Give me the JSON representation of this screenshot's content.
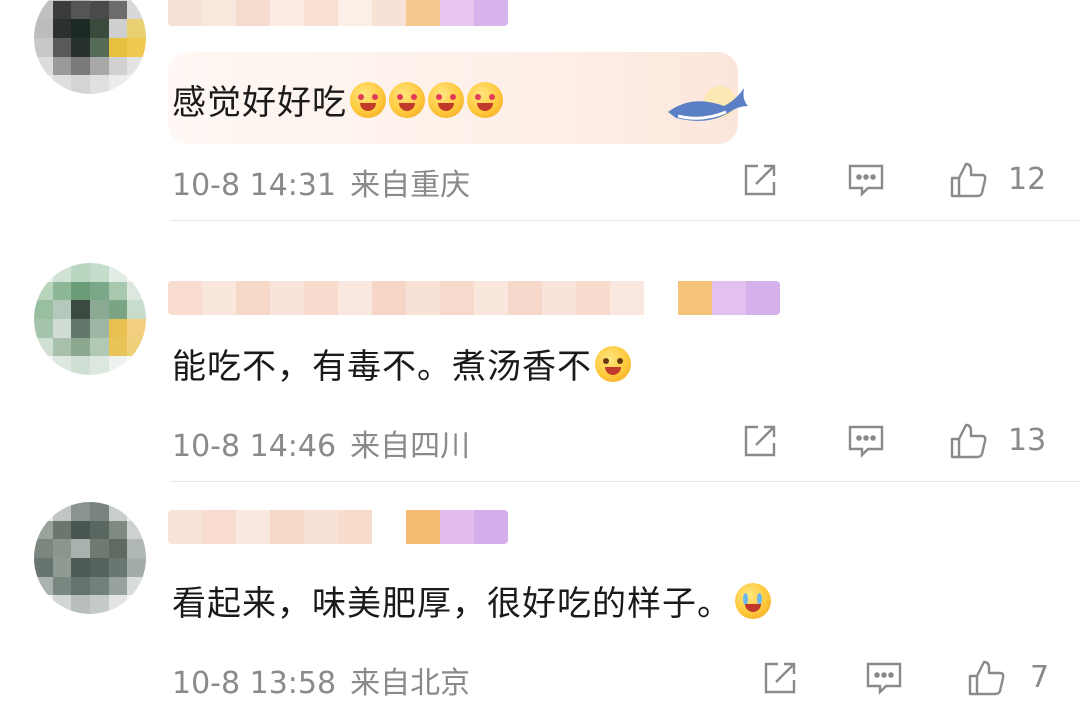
{
  "comments": [
    {
      "text": "感觉好好吃",
      "emoji": [
        "heart-eyes-emoji",
        "heart-eyes-emoji",
        "heart-eyes-emoji",
        "heart-eyes-emoji"
      ],
      "date": "10-8 14:31",
      "location": "来自重庆",
      "likes": "12"
    },
    {
      "text": "能吃不，有毒不。煮汤香不",
      "emoji": [
        "grin-emoji"
      ],
      "date": "10-8 14:46",
      "location": "来自四川",
      "likes": "13"
    },
    {
      "text": "看起来，味美肥厚，很好吃的样子。",
      "emoji": [
        "laugh-cry-emoji"
      ],
      "date": "10-8 13:58",
      "location": "来自北京",
      "likes": "7"
    }
  ],
  "icons": {
    "share": "share-icon",
    "reply": "reply-icon",
    "like": "thumbs-up-icon"
  },
  "colors": {
    "text": "#1a1a1a",
    "meta": "#8a8a8a",
    "bubble": "#fdeee6"
  }
}
